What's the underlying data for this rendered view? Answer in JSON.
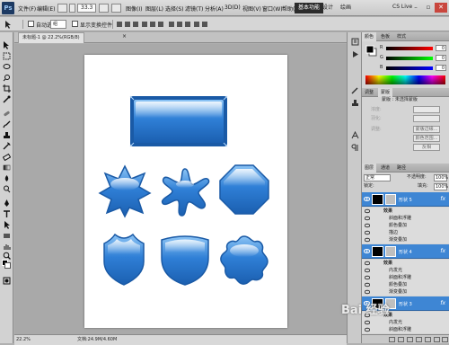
{
  "menubar": {
    "app_logo": "Ps",
    "items": [
      "文件(F)",
      "编辑(E)",
      "图像(I)",
      "图层(L)",
      "选择(S)",
      "滤镜(T)",
      "分析(A)",
      "3D(D)",
      "视图(V)",
      "窗口(W)",
      "帮助(H)"
    ],
    "zoom": "33.3",
    "workspaces": [
      "基本功能",
      "设计",
      "绘画"
    ],
    "cs_live": "CS Live"
  },
  "options_bar": {
    "auto_select_label": "自动选择:",
    "auto_select_value": "组",
    "transform_label": "显示变换控件"
  },
  "document": {
    "tab_title": "未标题-1 @ 22.2%(RGB/8)",
    "zoom_status": "22.2%",
    "doc_size": "文档:24.9M/4.60M",
    "shapes": [
      "rounded-rect",
      "star",
      "splat",
      "octagon",
      "shield",
      "shield-round",
      "flower"
    ],
    "shape_color": "#2f7fd6"
  },
  "panels": {
    "color_tabs": [
      "颜色",
      "色板",
      "样式"
    ],
    "color_sliders": [
      {
        "label": "R",
        "value": "0",
        "color": "#e33"
      },
      {
        "label": "G",
        "value": "0",
        "color": "#3b3"
      },
      {
        "label": "B",
        "value": "0",
        "color": "#33e"
      }
    ],
    "adjust_tabs": [
      "调整",
      "蒙版"
    ],
    "adjust_title": "蒙版 : 未选择蒙版",
    "adjust_rows": [
      {
        "label": "浓度:",
        "button": ""
      },
      {
        "label": "羽化:",
        "button": ""
      },
      {
        "label": "调整:",
        "button": "蒙版边缘..."
      },
      {
        "label": "",
        "button": "颜色范围..."
      },
      {
        "label": "",
        "button": "反相"
      }
    ],
    "layers_tabs": [
      "图层",
      "通道",
      "路径"
    ],
    "blend_mode": "正常",
    "opacity_label": "不透明度:",
    "opacity_value": "100%",
    "lock_label": "锁定:",
    "fill_label": "填充:",
    "fill_value": "100%",
    "layers": [
      {
        "name": "形状 5",
        "effects": [
          "效果",
          "斜面和浮雕",
          "颜色叠加",
          "描边",
          "渐变叠加"
        ]
      },
      {
        "name": "形状 4",
        "effects": [
          "效果",
          "内发光",
          "斜面和浮雕",
          "颜色叠加",
          "渐变叠加"
        ]
      },
      {
        "name": "形状 3",
        "effects": [
          "效果",
          "内发光",
          "斜面和浮雕"
        ]
      }
    ],
    "fx_symbol": "fx"
  },
  "watermark": "Bai 经验"
}
